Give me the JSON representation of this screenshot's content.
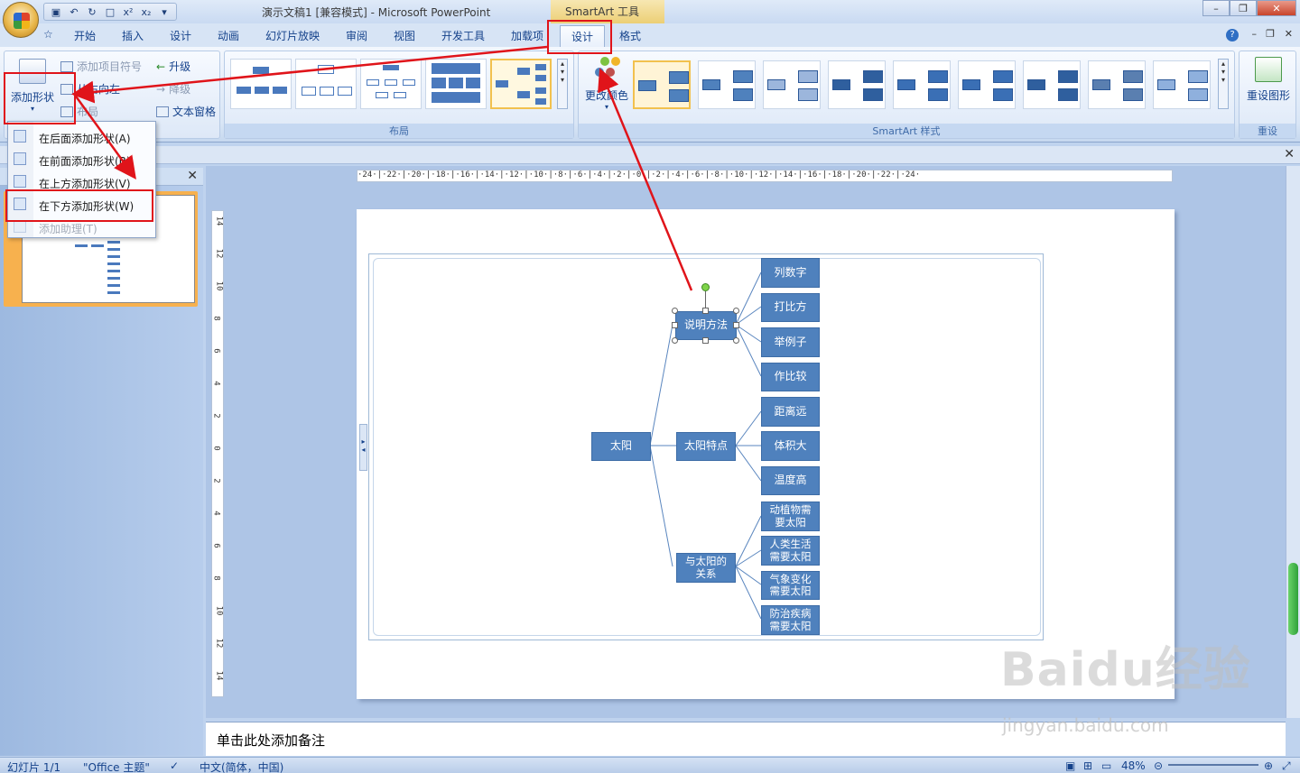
{
  "window": {
    "title": "演示文稿1 [兼容模式] - Microsoft PowerPoint",
    "context_tab_title": "SmartArt 工具"
  },
  "tabs": [
    "开始",
    "插入",
    "设计",
    "动画",
    "幻灯片放映",
    "审阅",
    "视图",
    "开发工具",
    "加载项"
  ],
  "context_tabs": {
    "design": "设计",
    "format": "格式"
  },
  "ribbon": {
    "add_shape": "添加形状",
    "add_bullet": "添加项目符号",
    "right_to_left": "从右向左",
    "layout_btn": "布局",
    "promote": "升级",
    "demote": "降级",
    "text_pane": "文本窗格",
    "layout_group": "布局",
    "change_colors": "更改颜色",
    "styles_group": "SmartArt 样式",
    "reset_graphic": "重设图形",
    "reset_group": "重设"
  },
  "dropdown": {
    "items": [
      "在后面添加形状(A)",
      "在前面添加形状(B)",
      "在上方添加形状(V)",
      "在下方添加形状(W)",
      "添加助理(T)"
    ]
  },
  "ruler": {
    "horizontal": "·24·|·22·|·20·|·18·|·16·|·14·|·12·|·10·|·8·|·6·|·4·|·2·|·0·|·2·|·4·|·6·|·8·|·10·|·12·|·14·|·16·|·18·|·20·|·22·|·24·",
    "vertical": [
      "14",
      "12",
      "10",
      "8",
      "6",
      "4",
      "2",
      "0",
      "2",
      "4",
      "6",
      "8",
      "10",
      "12",
      "14"
    ]
  },
  "diagram": {
    "root": "太阳",
    "level1": [
      "说明方法",
      "太阳特点",
      "与太阳的关系"
    ],
    "methods": [
      "列数字",
      "打比方",
      "举例子",
      "作比较"
    ],
    "features": [
      "距离远",
      "体积大",
      "温度高"
    ],
    "relations": [
      "动植物需要太阳",
      "人类生活需要太阳",
      "气象变化需要太阳",
      "防治疾病需要太阳"
    ]
  },
  "notes": {
    "placeholder": "单击此处添加备注"
  },
  "status": {
    "slide": "幻灯片 1/1",
    "theme": "\"Office 主题\"",
    "language": "中文(简体，中国)",
    "zoom": "48%"
  },
  "watermark": {
    "brand": "Baidu经验",
    "url": "jingyan.baidu.com"
  },
  "colors": {
    "node": "#4f81bd",
    "annotation": "#e0141a",
    "accent": "#f2c14e"
  }
}
